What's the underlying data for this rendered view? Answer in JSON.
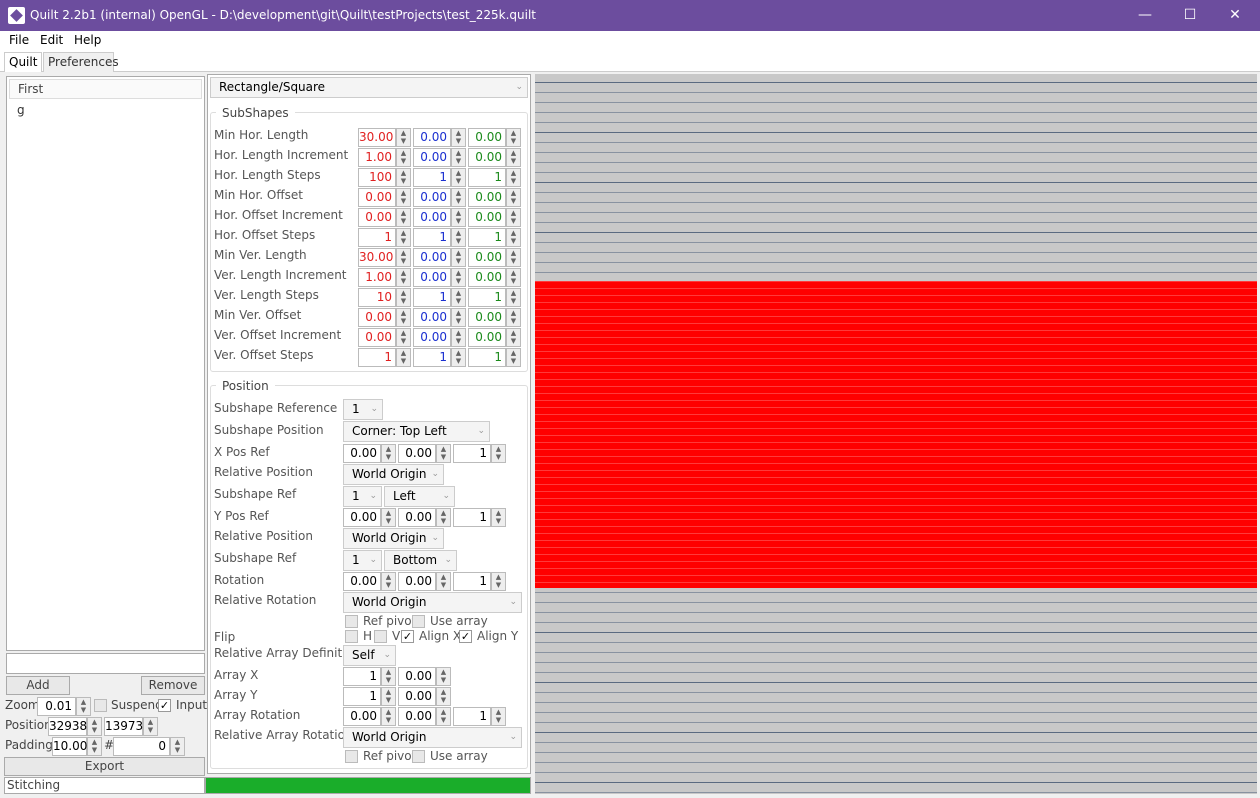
{
  "window": {
    "title": "Quilt 2.2b1 (internal) OpenGL - D:\\development\\git\\Quilt\\testProjects\\test_225k.quilt",
    "minimize": "—",
    "maximize": "☐",
    "close": "✕"
  },
  "menu": [
    "File",
    "Edit",
    "Help"
  ],
  "tabs": [
    "Quilt",
    "Preferences"
  ],
  "left": {
    "list_header": "First",
    "list_items": [
      "g"
    ],
    "add_label": "Add",
    "remove_label": "Remove",
    "zoom_label": "Zoom",
    "zoom_value": "0.01",
    "suspend_label": "Suspend",
    "input_label": "Input",
    "position_label": "Position",
    "position_x": "32938",
    "position_y": "13973",
    "padding_label": "Padding",
    "padding_value": "10.00",
    "hash_label": "#",
    "hash_value": "0",
    "export_label": "Export",
    "status": "Stitching"
  },
  "shape_type": "Rectangle/Square",
  "subshapes": {
    "title": "SubShapes",
    "rows": [
      {
        "label": "Min Hor. Length",
        "values": [
          "30.00",
          "0.00",
          "0.00"
        ]
      },
      {
        "label": "Hor. Length Increment",
        "values": [
          "1.00",
          "0.00",
          "0.00"
        ]
      },
      {
        "label": "Hor. Length Steps",
        "values": [
          "100",
          "1",
          "1"
        ]
      },
      {
        "label": "Min Hor. Offset",
        "values": [
          "0.00",
          "0.00",
          "0.00"
        ]
      },
      {
        "label": "Hor. Offset Increment",
        "values": [
          "0.00",
          "0.00",
          "0.00"
        ]
      },
      {
        "label": "Hor. Offset Steps",
        "values": [
          "1",
          "1",
          "1"
        ]
      },
      {
        "label": "Min Ver. Length",
        "values": [
          "30.00",
          "0.00",
          "0.00"
        ]
      },
      {
        "label": "Ver. Length Increment",
        "values": [
          "1.00",
          "0.00",
          "0.00"
        ]
      },
      {
        "label": "Ver. Length Steps",
        "values": [
          "10",
          "1",
          "1"
        ]
      },
      {
        "label": "Min Ver. Offset",
        "values": [
          "0.00",
          "0.00",
          "0.00"
        ]
      },
      {
        "label": "Ver. Offset Increment",
        "values": [
          "0.00",
          "0.00",
          "0.00"
        ]
      },
      {
        "label": "Ver. Offset Steps",
        "values": [
          "1",
          "1",
          "1"
        ]
      }
    ]
  },
  "position": {
    "title": "Position",
    "subshape_reference_label": "Subshape Reference",
    "subshape_reference": "1",
    "subshape_position_label": "Subshape Position",
    "subshape_position": "Corner: Top Left",
    "x_pos_ref_label": "X Pos Ref",
    "x_pos_ref": [
      "0.00",
      "0.00",
      "1"
    ],
    "relative_position_label": "Relative Position",
    "x_relative_position": "World Origin",
    "subshape_ref_label": "Subshape Ref",
    "x_subshape_ref": "1",
    "x_subshape_side": "Left",
    "y_pos_ref_label": "Y Pos Ref",
    "y_pos_ref": [
      "0.00",
      "0.00",
      "1"
    ],
    "y_relative_position": "World Origin",
    "y_subshape_ref": "1",
    "y_subshape_side": "Bottom",
    "rotation_label": "Rotation",
    "rotation": [
      "0.00",
      "0.00",
      "1"
    ],
    "relative_rotation_label": "Relative Rotation",
    "relative_rotation": "World Origin",
    "ref_pivot_label": "Ref pivot",
    "use_array_label": "Use array",
    "flip_label": "Flip",
    "flip_h": "H",
    "flip_v": "V",
    "align_x": "Align X",
    "align_y": "Align Y",
    "relative_array_definition_label": "Relative Array Definition",
    "relative_array_definition": "Self",
    "array_x_label": "Array X",
    "array_x": [
      "1",
      "0.00"
    ],
    "array_y_label": "Array Y",
    "array_y": [
      "1",
      "0.00"
    ],
    "array_rotation_label": "Array Rotation",
    "array_rotation": [
      "0.00",
      "0.00",
      "1"
    ],
    "relative_array_rotation_label": "Relative Array Rotation",
    "relative_array_rotation": "World Origin"
  },
  "progress_fraction": 1.0,
  "colors": {
    "titlebar": "#6c4d9e",
    "shape_fill": "#ff0000",
    "viewport_bg": "#c8c8c8",
    "gridline": "#5a6a80",
    "progress": "#1aad2a"
  }
}
